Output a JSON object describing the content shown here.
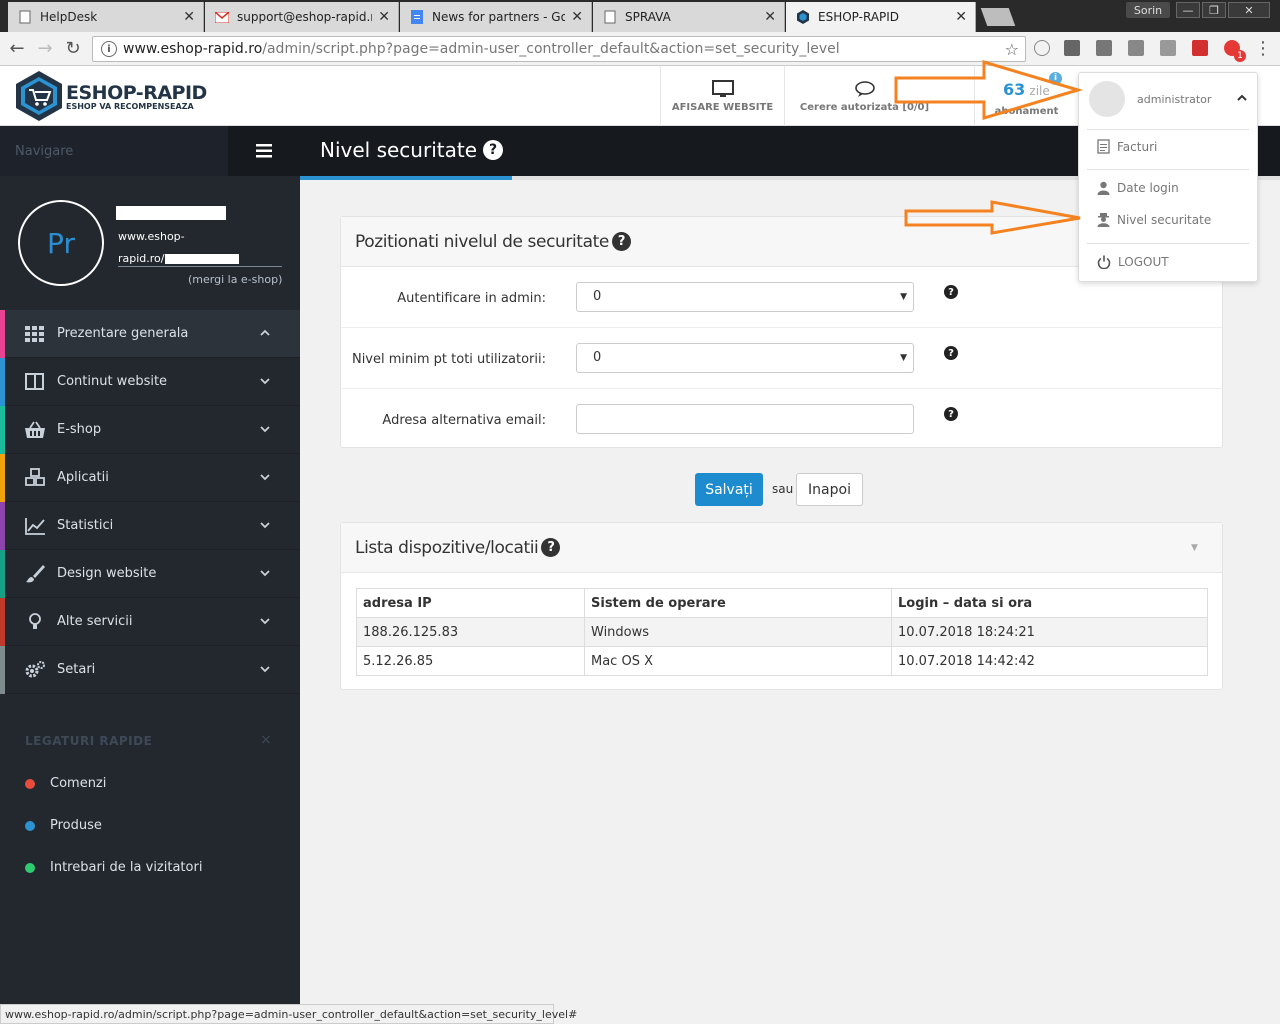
{
  "browser": {
    "tabs": [
      {
        "title": "HelpDesk"
      },
      {
        "title": "support@eshop-rapid.ro"
      },
      {
        "title": "News for partners - Goog"
      },
      {
        "title": "SPRAVA"
      },
      {
        "title": "ESHOP-RAPID"
      }
    ],
    "user": "Sorin",
    "url_host": "www.eshop-rapid.ro",
    "url_path": "/admin/script.php?page=admin-user_controller_default&action=set_security_level",
    "status_url": "www.eshop-rapid.ro/admin/script.php?page=admin-user_controller_default&action=set_security_level#",
    "extension_badge": "1"
  },
  "header": {
    "brand": "ESHOP-RAPID",
    "tagline": "ESHOP VA RECOMPENSEAZA",
    "display_website": "AFISARE WEBSITE",
    "auth_request": "Cerere autorizata [0/0]",
    "days_count": "63",
    "days_unit": "zile",
    "subscription": "abonament"
  },
  "topbar": {
    "nav_label": "Navigare",
    "page_title": "Nivel securitate"
  },
  "profile": {
    "initials": "Pr",
    "url_line1": "www.eshop-",
    "url_line2": "rapid.ro/",
    "go_shop": "(mergi la e-shop)"
  },
  "menu": [
    {
      "label": "Prezentare generala",
      "color": "#e84393"
    },
    {
      "label": "Continut website",
      "color": "#2b93d1"
    },
    {
      "label": "E-shop",
      "color": "#1abc9c"
    },
    {
      "label": "Aplicatii",
      "color": "#f0a30a"
    },
    {
      "label": "Statistici",
      "color": "#8e44ad"
    },
    {
      "label": "Design website",
      "color": "#16a085"
    },
    {
      "label": "Alte servicii",
      "color": "#c0392b"
    },
    {
      "label": "Setari",
      "color": "#7f8c8d"
    }
  ],
  "quick": {
    "heading": "LEGATURI RAPIDE",
    "close": "×",
    "links": [
      {
        "label": "Comenzi",
        "color": "#e74c3c"
      },
      {
        "label": "Produse",
        "color": "#2b93d1"
      },
      {
        "label": "Intrebari de la vizitatori",
        "color": "#2ecc71"
      }
    ]
  },
  "security_panel": {
    "title": "Pozitionati nivelul de securitate",
    "fields": [
      {
        "label": "Autentificare in admin:",
        "value": "0"
      },
      {
        "label": "Nivel minim pt toti utilizatorii:",
        "value": "0"
      },
      {
        "label": "Adresa alternativa email:",
        "value": ""
      }
    ]
  },
  "actions": {
    "save": "Salvați",
    "or": "sau",
    "back": "Inapoi"
  },
  "devices_panel": {
    "title": "Lista dispozitive/locatii",
    "columns": [
      "adresa IP",
      "Sistem de operare",
      "Login – data si ora"
    ],
    "rows": [
      [
        "188.26.125.83",
        "Windows",
        "10.07.2018 18:24:21"
      ],
      [
        "5.12.26.85",
        "Mac OS X",
        "10.07.2018 14:42:42"
      ]
    ]
  },
  "dropdown": {
    "username": "administrator",
    "items": [
      {
        "label": "Facturi"
      },
      {
        "label": "Date login"
      },
      {
        "label": "Nivel securitate"
      },
      {
        "label": "LOGOUT"
      }
    ]
  },
  "colors": {
    "accent": "#2b93d1",
    "arrow": "#f58220",
    "sidebar": "#23282f",
    "topbar": "#16191e"
  }
}
